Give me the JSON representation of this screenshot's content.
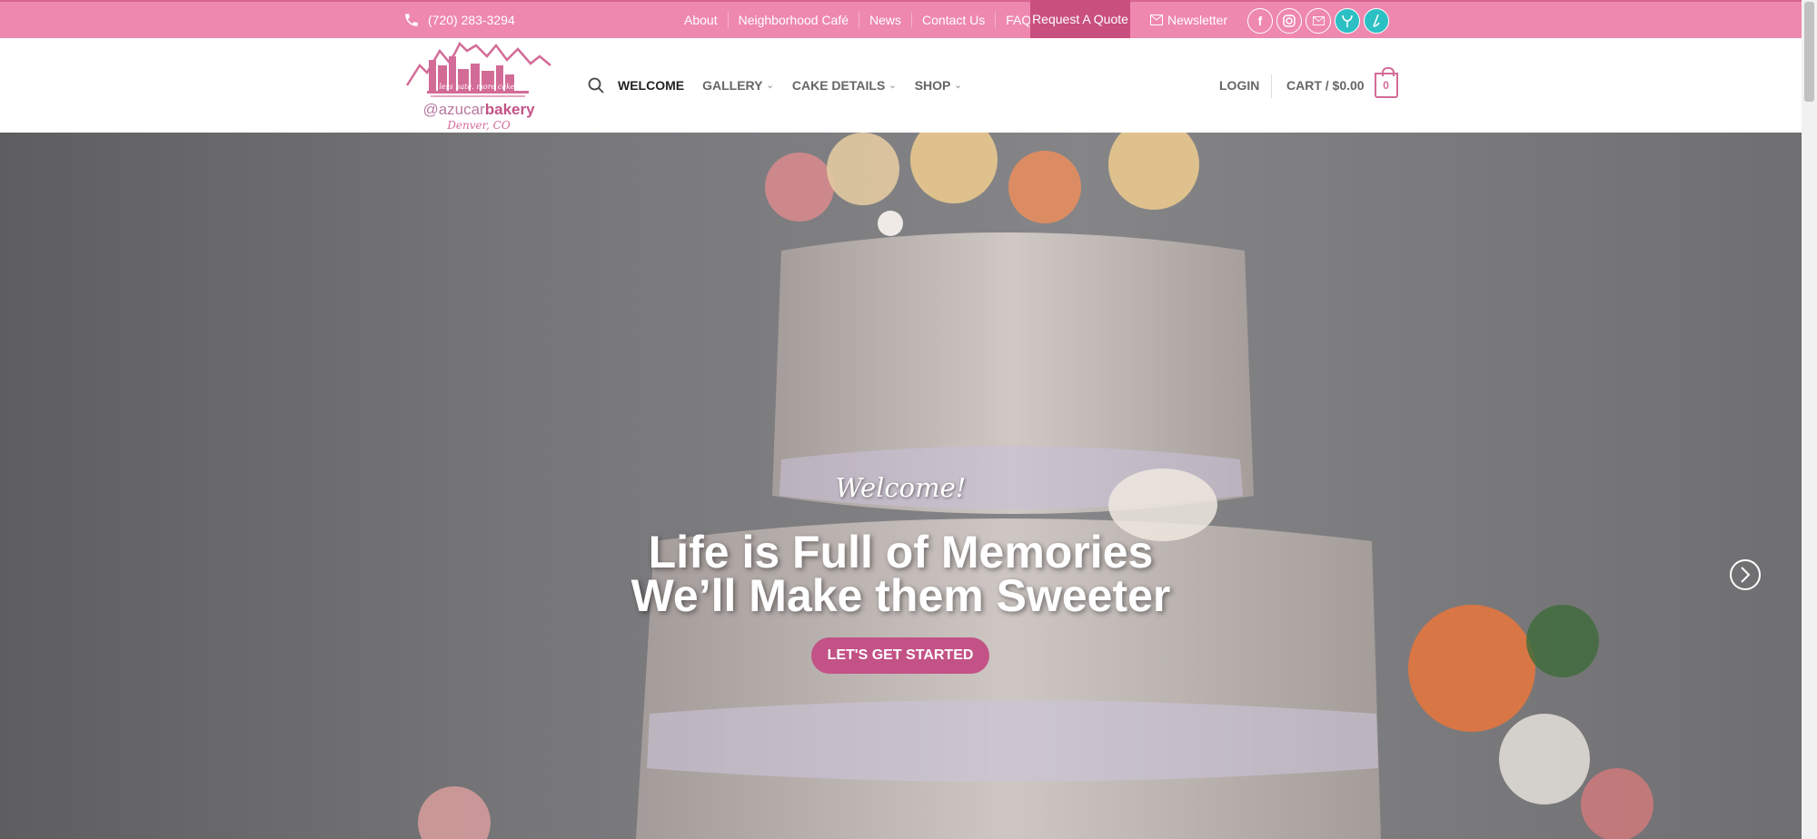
{
  "topbar": {
    "phone": "(720) 283-3294",
    "links": [
      "About",
      "Neighborhood Café",
      "News",
      "Contact Us",
      "FAQ"
    ],
    "quote": "Request A Quote",
    "newsletter": "Newsletter",
    "socials": [
      "facebook-icon",
      "instagram-icon",
      "email-icon",
      "tripadvisor-icon",
      "yelp-icon"
    ]
  },
  "logo": {
    "tagline": "less hate. more cake",
    "name_prefix": "@azucar",
    "name_main": "bakery",
    "location": "Denver, CO"
  },
  "nav": {
    "welcome": "WELCOME",
    "gallery": "GALLERY",
    "cake_details": "CAKE DETAILS",
    "shop": "SHOP",
    "login": "LOGIN",
    "cart": "CART / $0.00",
    "cart_count": "0"
  },
  "hero": {
    "script": "Welcome!",
    "line1": "Life is Full of Memories",
    "line2": "We’ll Make them Sweeter",
    "cta": "LET'S GET STARTED"
  },
  "colors": {
    "topbar": "#ee88af",
    "accent": "#c35286"
  }
}
